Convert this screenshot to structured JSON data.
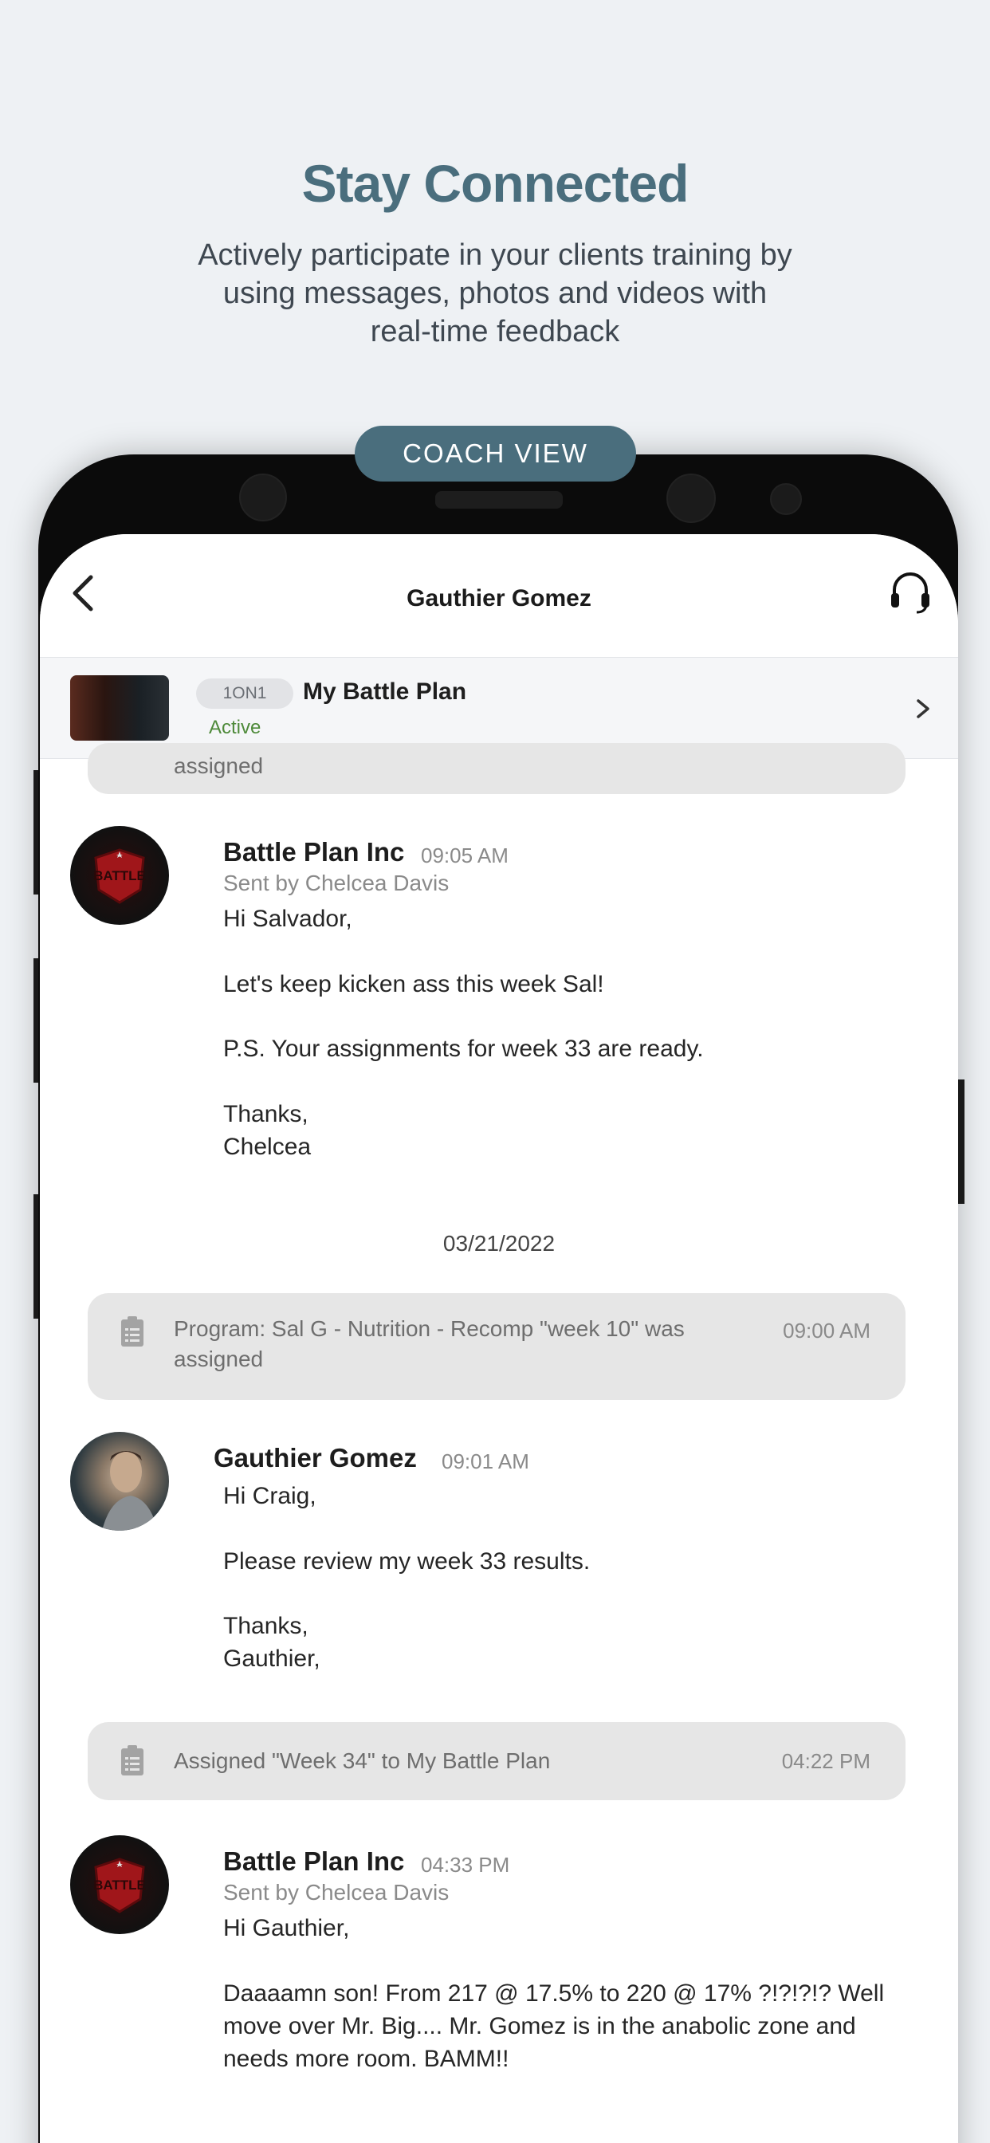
{
  "hero": {
    "title": "Stay Connected",
    "subtitle_lines": [
      "Actively participate in your clients training by",
      "using messages, photos and videos with",
      "real-time feedback"
    ]
  },
  "badge": "COACH VIEW",
  "nav": {
    "title": "Gauthier Gomez",
    "back_icon": "chevron-left-icon",
    "support_icon": "headset-icon"
  },
  "plan": {
    "tag": "1ON1",
    "name": "My Battle Plan",
    "status": "Active",
    "status_color": "#4e8a3a"
  },
  "feed": {
    "top_sys_partial": "assigned",
    "msg1": {
      "name": "Battle Plan Inc",
      "time": "09:05 AM",
      "sent_by": "Sent by Chelcea Davis",
      "lines": [
        "Hi Salvador,",
        "Let's keep kicken ass this week Sal!",
        "P.S. Your assignments for week 33 are ready.",
        "Thanks,",
        "Chelcea"
      ]
    },
    "date": "03/21/2022",
    "sys1": {
      "line1": "Program: Sal G - Nutrition - Recomp \"week 10\" was",
      "line2": "assigned",
      "time": "09:00 AM"
    },
    "msg2": {
      "name": "Gauthier  Gomez",
      "time": "09:01 AM",
      "lines": [
        "Hi Craig,",
        "Please review my week 33 results.",
        "Thanks,",
        "Gauthier,"
      ]
    },
    "sys2": {
      "text": "Assigned \"Week 34\" to My Battle Plan",
      "time": "04:22 PM"
    },
    "msg3": {
      "name": "Battle Plan Inc",
      "time": "04:33 PM",
      "sent_by": "Sent by Chelcea Davis",
      "lines": [
        "Hi  Gauthier,",
        "Daaaamn son! From 217 @ 17.5% to 220 @ 17% ?!?!?!? Well",
        "move over Mr. Big.... Mr. Gomez is in the anabolic zone and",
        "needs more room. BAMM!!"
      ]
    },
    "logo_text": "BATTLE"
  },
  "colors": {
    "accent": "#4a6e7d",
    "system_bubble": "#e6e6e6"
  }
}
